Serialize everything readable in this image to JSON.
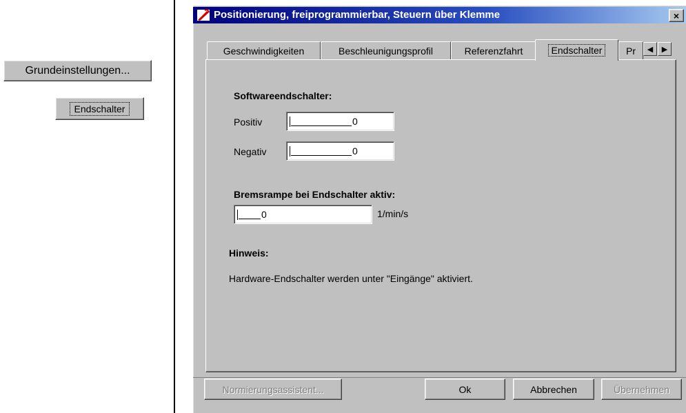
{
  "left_panel": {
    "grundeinstellungen_label": "Grundeinstellungen...",
    "endschalter_label": "Endschalter"
  },
  "dialog": {
    "title": "Positionierung, freiprogrammierbar, Steuern über Klemme",
    "close_symbol": "×",
    "title_gradient": [
      "#00007b",
      "#a6caf0"
    ],
    "tabs": [
      {
        "label": "Geschwindigkeiten"
      },
      {
        "label": "Beschleunigungsprofil"
      },
      {
        "label": "Referenzfahrt"
      },
      {
        "label": "Endschalter"
      },
      {
        "label": "Pr"
      }
    ],
    "active_tab": "Endschalter",
    "scroll_left": "◀",
    "scroll_right": "▶"
  },
  "endschalter_page": {
    "software_heading": "Softwareendschalter:",
    "positiv_label": "Positiv",
    "positiv_value": "0",
    "negativ_label": "Negativ",
    "negativ_value": "0",
    "bremsrampe_heading": "Bremsrampe bei Endschalter aktiv:",
    "bremsrampe_value": "0",
    "bremsrampe_unit": "1/min/s",
    "hinweis_heading": "Hinweis:",
    "hinweis_text": "Hardware-Endschalter werden unter \"Eingänge\" aktiviert."
  },
  "buttons": {
    "normierung": "Normierungsassistent...",
    "ok": "Ok",
    "abbrechen": "Abbrechen",
    "uebernehmen": "Übernehmen"
  },
  "colors": {
    "face": "#c0c0c0",
    "disabled_text": "#808080"
  }
}
